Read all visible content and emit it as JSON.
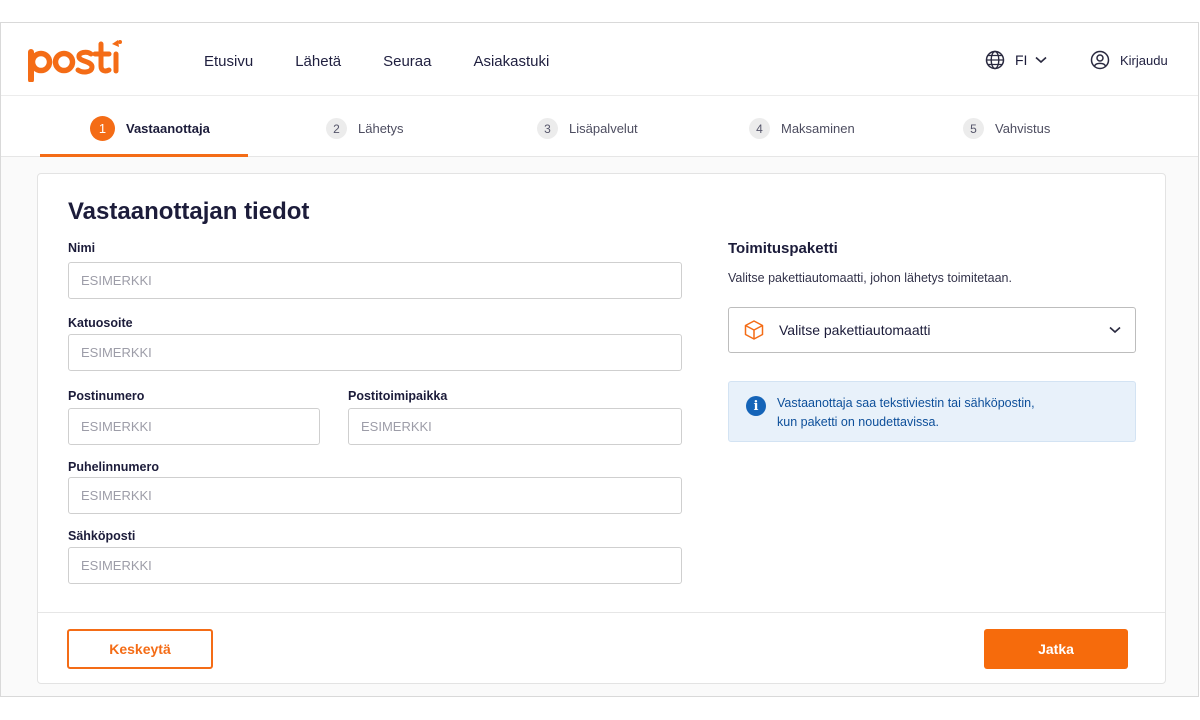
{
  "brand": {
    "logo_text": "posti",
    "color": "#f46c16"
  },
  "nav": {
    "items": [
      "Etusivu",
      "Lähetä",
      "Seuraa",
      "Asiakastuki"
    ],
    "language": "FI",
    "login": "Kirjaudu"
  },
  "stepper": {
    "active": 1,
    "steps": [
      {
        "num": "1",
        "label": "Vastaanottaja"
      },
      {
        "num": "2",
        "label": "Lähetys"
      },
      {
        "num": "3",
        "label": "Lisäpalvelut"
      },
      {
        "num": "4",
        "label": "Maksaminen"
      },
      {
        "num": "5",
        "label": "Vahvistus"
      }
    ]
  },
  "form": {
    "title": "Vastaanottajan tiedot",
    "fields": {
      "name": {
        "label": "Nimi",
        "placeholder": "ESIMERKKI"
      },
      "street": {
        "label": "Katuosoite",
        "placeholder": "ESIMERKKI"
      },
      "postal_code": {
        "label": "Postinumero",
        "placeholder": "ESIMERKKI"
      },
      "city": {
        "label": "Postitoimipaikka",
        "placeholder": "ESIMERKKI"
      },
      "phone": {
        "label": "Puhelinnumero",
        "placeholder": "ESIMERKKI"
      },
      "email": {
        "label": "Sähköposti",
        "placeholder": "ESIMERKKI"
      }
    }
  },
  "delivery": {
    "title": "Toimituspaketti",
    "description": "Valitse pakettiautomaatti, johon lähetys toimitetaan.",
    "select_label": "Valitse pakettiautomaatti"
  },
  "info": {
    "icon": "info-icon",
    "line1": "Vastaanottaja saa tekstiviestin tai sähköpostin,",
    "line2": "kun paketti on noudettavissa."
  },
  "actions": {
    "cancel": "Keskeytä",
    "continue": "Jatka"
  }
}
